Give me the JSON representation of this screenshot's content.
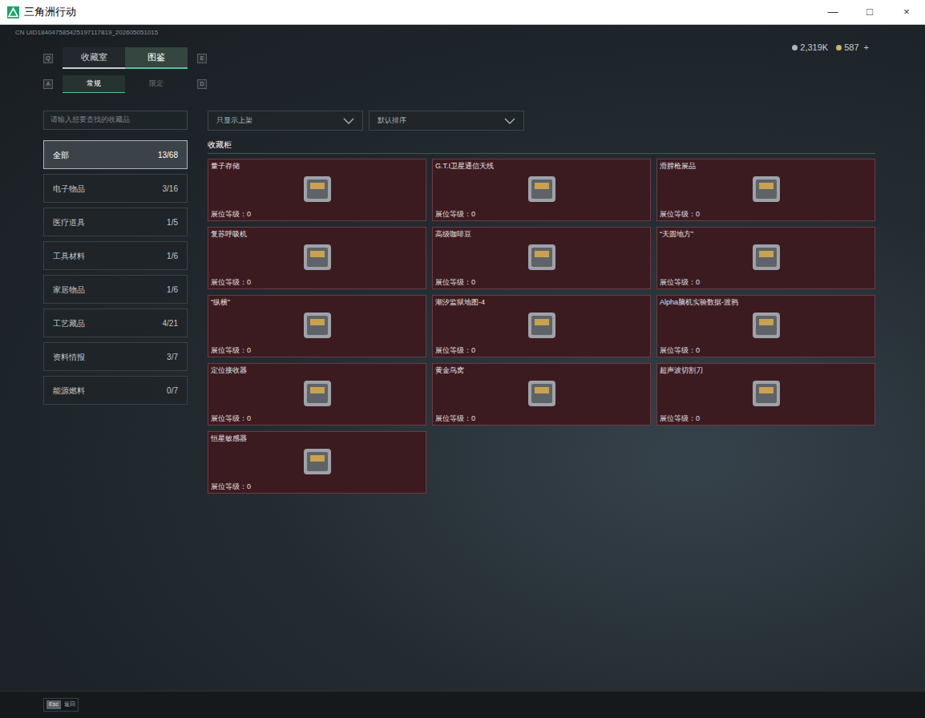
{
  "window": {
    "title": "三角洲行动",
    "controls": [
      "—",
      "□",
      "×"
    ]
  },
  "uid": "CN UID184047585425197117819_202605051015",
  "currency": [
    {
      "value": "2,319K",
      "suffix": ""
    },
    {
      "value": "587",
      "suffix": "+"
    }
  ],
  "main_tabs": {
    "hint_left": "Q",
    "hint_right": "E",
    "items": [
      {
        "label": "收藏室",
        "selected": false
      },
      {
        "label": "图鉴",
        "selected": true
      }
    ]
  },
  "sub_tabs": {
    "hint_left": "A",
    "hint_right": "D",
    "items": [
      {
        "label": "常规",
        "selected": true
      },
      {
        "label": "限定",
        "selected": false
      }
    ]
  },
  "search": {
    "placeholder": "请输入想要查找的收藏品"
  },
  "filters": [
    {
      "label": "只显示上架"
    },
    {
      "label": "默认排序"
    }
  ],
  "categories": [
    {
      "label": "全部",
      "count": "13/68",
      "selected": true
    },
    {
      "label": "电子物品",
      "count": "3/16",
      "selected": false
    },
    {
      "label": "医疗道具",
      "count": "1/5",
      "selected": false
    },
    {
      "label": "工具材料",
      "count": "1/6",
      "selected": false
    },
    {
      "label": "家居物品",
      "count": "1/6",
      "selected": false
    },
    {
      "label": "工艺藏品",
      "count": "4/21",
      "selected": false
    },
    {
      "label": "资料情报",
      "count": "3/7",
      "selected": false
    },
    {
      "label": "能源燃料",
      "count": "0/7",
      "selected": false
    }
  ],
  "section_title": "收藏柜",
  "items": [
    {
      "name": "量子存储",
      "level": "展位等级：0"
    },
    {
      "name": "G.T.I卫星通信天线",
      "level": "展位等级：0"
    },
    {
      "name": "滑膛枪展品",
      "level": "展位等级：0"
    },
    {
      "name": "复苏呼吸机",
      "level": "展位等级：0"
    },
    {
      "name": "高级咖啡豆",
      "level": "展位等级：0"
    },
    {
      "name": "“天圆地方”",
      "level": "展位等级：0"
    },
    {
      "name": "“纵横”",
      "level": "展位等级：0"
    },
    {
      "name": "潮汐监狱地图-4",
      "level": "展位等级：0"
    },
    {
      "name": "Alpha脑机实验数据-渡鸦",
      "level": "展位等级：0"
    },
    {
      "name": "定位接收器",
      "level": "展位等级：0"
    },
    {
      "name": "黄金鸟窝",
      "level": "展位等级：0"
    },
    {
      "name": "超声波切割刀",
      "level": "展位等级：0"
    },
    {
      "name": "恒星敏感器",
      "level": "展位等级：0"
    }
  ],
  "footer": {
    "key": "Esc",
    "label": "返回"
  }
}
